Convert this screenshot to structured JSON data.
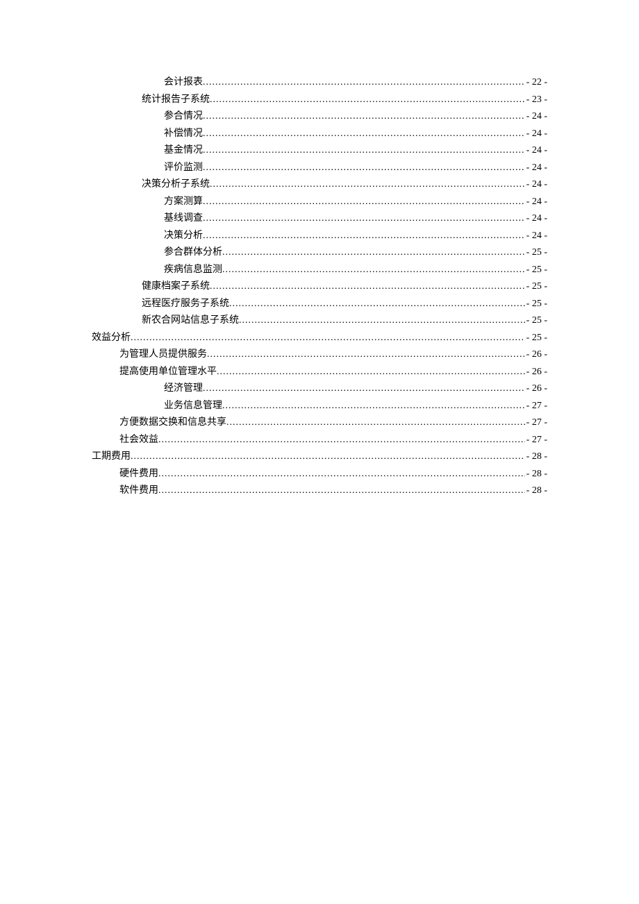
{
  "toc": [
    {
      "level": 3,
      "title": "会计报表",
      "page": "- 22 -"
    },
    {
      "level": 2,
      "title": "统计报告子系统",
      "page": "- 23 -"
    },
    {
      "level": 3,
      "title": "参合情况",
      "page": "- 24 -"
    },
    {
      "level": 3,
      "title": "补偿情况",
      "page": "- 24 -"
    },
    {
      "level": 3,
      "title": "基金情况",
      "page": "- 24 -"
    },
    {
      "level": 3,
      "title": "评价监测",
      "page": "- 24 -"
    },
    {
      "level": 2,
      "title": "决策分析子系统",
      "page": "- 24 -"
    },
    {
      "level": 3,
      "title": "方案测算",
      "page": "- 24 -"
    },
    {
      "level": 3,
      "title": "基线调查",
      "page": "- 24 -"
    },
    {
      "level": 3,
      "title": "决策分析",
      "page": "- 24 -"
    },
    {
      "level": 3,
      "title": "参合群体分析",
      "page": "- 25 -"
    },
    {
      "level": 3,
      "title": "疾病信息监测",
      "page": "- 25 -"
    },
    {
      "level": 2,
      "title": "健康档案子系统",
      "page": "- 25 -"
    },
    {
      "level": 2,
      "title": "远程医疗服务子系统",
      "page": "- 25 -"
    },
    {
      "level": 2,
      "title": "新农合网站信息子系统",
      "page": "- 25 -"
    },
    {
      "level": 0,
      "title": "效益分析",
      "page": "- 25 -"
    },
    {
      "level": 1,
      "title": "为管理人员提供服务",
      "page": "- 26 -"
    },
    {
      "level": 1,
      "title": "提高使用单位管理水平",
      "page": "- 26 -"
    },
    {
      "level": 3,
      "title": "经济管理",
      "page": "- 26 -"
    },
    {
      "level": 3,
      "title": "业务信息管理",
      "page": "- 27 -"
    },
    {
      "level": 1,
      "title": "方便数据交换和信息共享",
      "page": "- 27 -"
    },
    {
      "level": 1,
      "title": "社会效益",
      "page": "- 27 -"
    },
    {
      "level": 0,
      "title": "工期费用",
      "page": "- 28 -"
    },
    {
      "level": 1,
      "title": "硬件费用",
      "page": "- 28 -"
    },
    {
      "level": 1,
      "title": "软件费用",
      "page": "- 28 -"
    }
  ]
}
